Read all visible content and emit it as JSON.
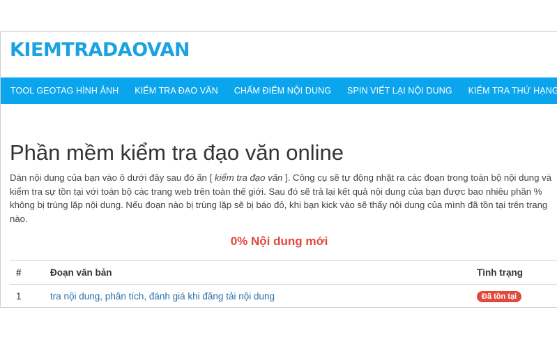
{
  "header": {
    "logo_text": "KIEMTRADAOVAN"
  },
  "nav": {
    "items": [
      "TOOL GEOTAG HÌNH ẢNH",
      "KIỂM TRA ĐẠO VĂN",
      "CHẤM ĐIỂM NỘI DUNG",
      "SPIN VIẾT LẠI NỘI DUNG",
      "KIỂM TRA THỨ HẠNG TỪ KHÓA"
    ]
  },
  "main": {
    "title": "Phần mềm kiểm tra đạo văn online",
    "description_before": "Dán nội dung của bạn vào ô dưới đây sau đó ấn [ ",
    "description_emph": "kiểm tra đạo văn",
    "description_after": " ]. Công cụ sẽ tự động nhặt ra các đoạn trong toàn bộ nội dung và kiểm tra sự tồn tại với toàn bộ các trang web trên toàn thế giới. Sau đó sẽ trả lại kết quả nội dung của bạn được bao nhiêu phần % không bị trùng lặp nội dung. Nếu đoạn nào bị trùng lặp sẽ bị báo đỏ, khi bạn kick vào sẽ thấy nội dung của mình đã tồn tại trên trang nào.",
    "result_text": "0% Nội dung mới"
  },
  "table": {
    "headers": [
      "#",
      "Đoạn văn bản",
      "Tình trạng"
    ],
    "rows": [
      {
        "num": "1",
        "text": "tra nội dung, phân tích, đánh giá khi đăng tải nội dung",
        "status": "Đã tồn tại"
      }
    ]
  },
  "colors": {
    "brand": "#1aa3e0",
    "nav_bg": "#0ba5ee",
    "result": "#e0483c",
    "badge": "#e04a3c",
    "link": "#2c6fa8"
  }
}
